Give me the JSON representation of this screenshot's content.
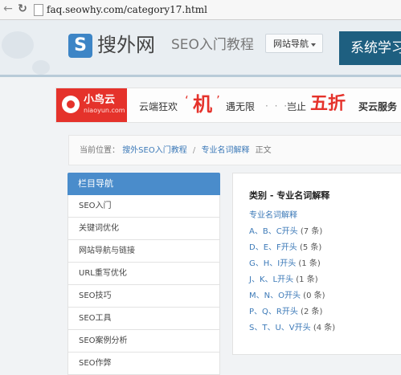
{
  "browser": {
    "url": "faq.seowhy.com/category17.html"
  },
  "header": {
    "logo_letter": "S",
    "logo_text": "搜外网",
    "slogan": "SEO入门教程",
    "nav_dropdown": "网站导航",
    "learn_button": "系统学习"
  },
  "banner": {
    "brand": "小鸟云",
    "domain": "niaoyun.com",
    "text1": "云端狂欢",
    "quote_open": "‘",
    "big1": "机",
    "quote_close": "’",
    "text2": "遇无限",
    "dots": "· · ·",
    "text3": "岂止",
    "big2": "五折",
    "text4": "买云服务"
  },
  "breadcrumb": {
    "prefix": "当前位置：",
    "home": "搜外SEO入门教程",
    "sep": "/",
    "category": "专业名词解释",
    "suffix": "正文"
  },
  "sidebar": {
    "title": "栏目导航",
    "items": [
      {
        "label": "SEO入门"
      },
      {
        "label": "关键词优化"
      },
      {
        "label": "网站导航与链接"
      },
      {
        "label": "URL重写优化"
      },
      {
        "label": "SEO技巧"
      },
      {
        "label": "SEO工具"
      },
      {
        "label": "SEO案例分析"
      },
      {
        "label": "SEO作弊"
      }
    ]
  },
  "content": {
    "title": "类别 - 专业名词解释",
    "subtitle": "专业名词解释",
    "items": [
      {
        "link": "A、B、C开头",
        "count": "(7 条)"
      },
      {
        "link": "D、E、F开头",
        "count": "(5 条)"
      },
      {
        "link": "G、H、I开头",
        "count": "(1 条)"
      },
      {
        "link": "J、K、L开头",
        "count": "(1 条)"
      },
      {
        "link": "M、N、O开头",
        "count": "(0 条)"
      },
      {
        "link": "P、Q、R开头",
        "count": "(2 条)"
      },
      {
        "link": "S、T、U、V开头",
        "count": "(4 条)"
      }
    ]
  },
  "colors": {
    "accent": "#4a8ccb",
    "link": "#3d7ab8",
    "banner_red": "#e5322b",
    "header_button": "#1e5f80"
  }
}
